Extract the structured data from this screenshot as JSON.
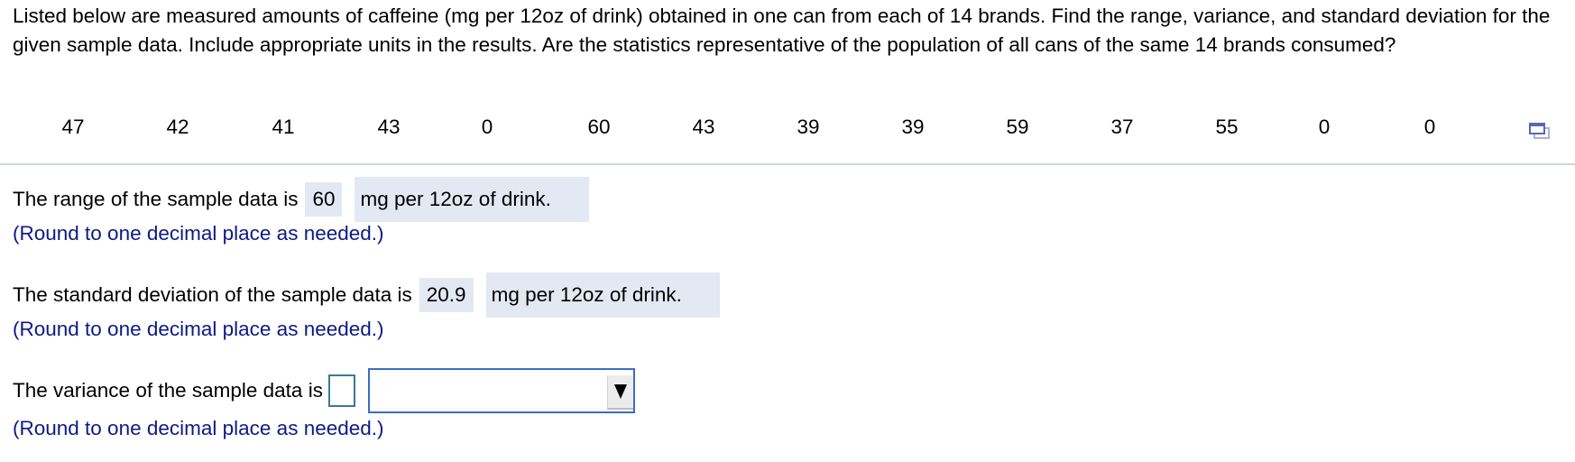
{
  "question": {
    "text": "Listed below are measured amounts of caffeine (mg per 12oz of drink) obtained in one can from each of 14 brands. Find the range, variance, and standard deviation for the given sample data. Include appropriate units in the results. Are the statistics representative of the population of all cans of the same 14 brands consumed?"
  },
  "data_values": [
    "47",
    "42",
    "41",
    "43",
    "0",
    "60",
    "43",
    "39",
    "39",
    "59",
    "37",
    "55",
    "0",
    "0"
  ],
  "icons": {
    "copy": "copy-data-icon"
  },
  "range": {
    "label": "The range of the sample data is",
    "value": "60",
    "unit": "mg per 12oz of drink.",
    "hint": "(Round to one decimal place as needed.)"
  },
  "std_dev": {
    "label": "The standard deviation of the sample data is",
    "value": "20.9",
    "unit": "mg per 12oz of drink.",
    "hint": "(Round to one decimal place as needed.)"
  },
  "variance": {
    "label": "The variance of the sample data is",
    "value": "",
    "unit_selected": "",
    "hint": "(Round to one decimal place as needed.)"
  },
  "colors": {
    "hint": "#0d1a85",
    "answer_bg": "#e3e8f2",
    "select_border": "#3c6bc4"
  }
}
